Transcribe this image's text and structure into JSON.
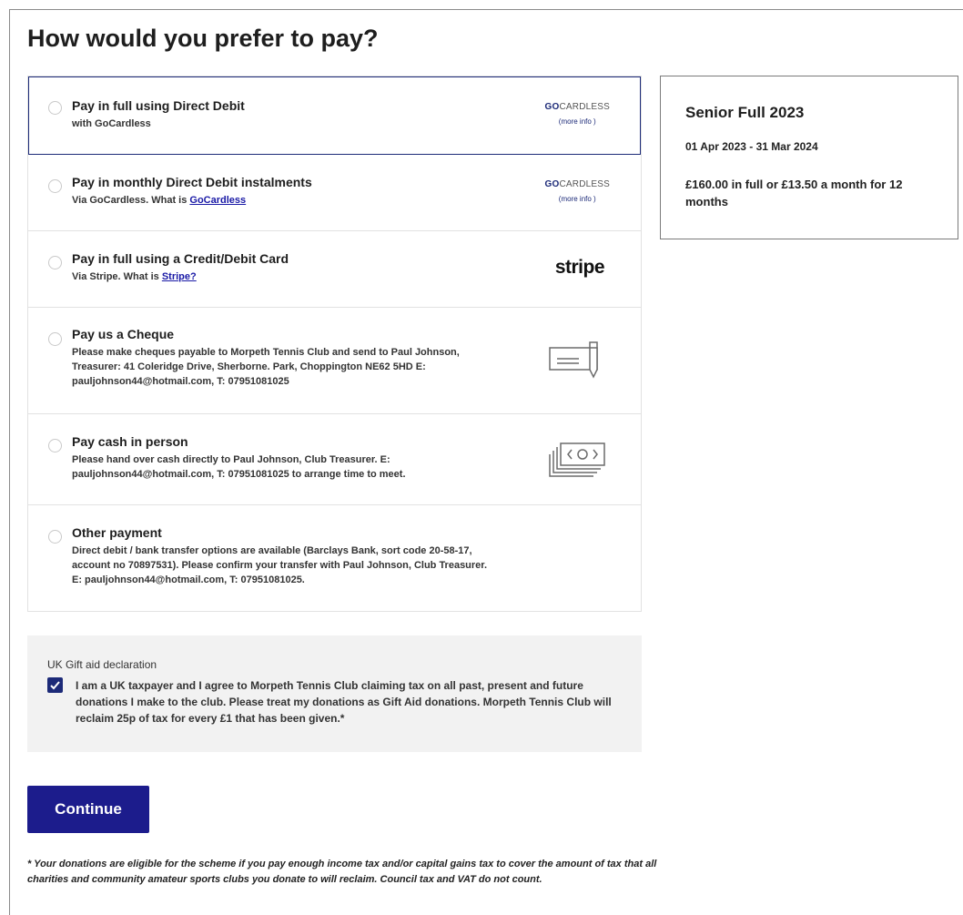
{
  "page_title": "How would you prefer to pay?",
  "payment_options": [
    {
      "title": "Pay in full using Direct Debit",
      "desc": "with GoCardless",
      "logo_bold": "GO",
      "logo_rest": "CARDLESS",
      "more_info": "(more info )",
      "selected": true
    },
    {
      "title": "Pay in monthly Direct Debit instalments",
      "desc_prefix": "Via GoCardless. What is ",
      "desc_link": "GoCardless",
      "logo_bold": "GO",
      "logo_rest": "CARDLESS",
      "more_info": "(more info )"
    },
    {
      "title": "Pay in full using a Credit/Debit Card",
      "desc_prefix": "Via Stripe. What is ",
      "desc_link": "Stripe?",
      "logo_text": "stripe"
    },
    {
      "title": "Pay us a Cheque",
      "desc": "Please make cheques payable to Morpeth Tennis Club and send to Paul Johnson, Treasurer: 41 Coleridge Drive, Sherborne. Park, Choppington NE62 5HD E: pauljohnson44@hotmail.com, T: 07951081025",
      "icon": "cheque-icon"
    },
    {
      "title": "Pay cash in person",
      "desc": "Please hand over cash directly to Paul Johnson, Club Treasurer. E: pauljohnson44@hotmail.com, T: 07951081025 to arrange time to meet.",
      "icon": "cash-icon"
    },
    {
      "title": "Other payment",
      "desc": "Direct debit / bank transfer options are available (Barclays Bank, sort code 20-58-17, account no 70897531). Please confirm your transfer with Paul Johnson, Club Treasurer. E: pauljohnson44@hotmail.com, T: 07951081025."
    }
  ],
  "summary": {
    "title": "Senior Full 2023",
    "dates": "01 Apr 2023 - 31 Mar 2024",
    "price": "£160.00 in full or £13.50 a month for 12 months"
  },
  "gift_aid": {
    "label": "UK Gift aid declaration",
    "checked": true,
    "text": "I am a UK taxpayer and I agree to Morpeth Tennis Club claiming tax on all past, present and future donations I make to the club. Please treat my donations as Gift Aid donations. Morpeth Tennis Club will reclaim 25p of tax for every £1 that has been given.*"
  },
  "continue_label": "Continue",
  "footnote": "* Your donations are eligible for the scheme if you pay enough income tax and/or capital gains tax to cover the amount of tax that all charities and community amateur sports clubs you donate to will reclaim. Council tax and VAT do not count.",
  "colors": {
    "accent": "#1c2a78",
    "button": "#1c1c8c",
    "link": "#1a1aa6"
  }
}
